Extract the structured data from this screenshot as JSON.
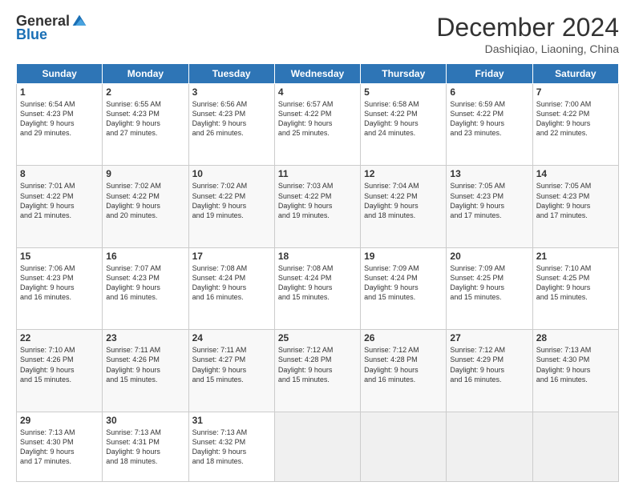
{
  "logo": {
    "general": "General",
    "blue": "Blue"
  },
  "header": {
    "title": "December 2024",
    "location": "Dashiqiao, Liaoning, China"
  },
  "days_of_week": [
    "Sunday",
    "Monday",
    "Tuesday",
    "Wednesday",
    "Thursday",
    "Friday",
    "Saturday"
  ],
  "weeks": [
    [
      {
        "day": "1",
        "rise": "6:54 AM",
        "set": "4:23 PM",
        "hours": "9",
        "mins": "29"
      },
      {
        "day": "2",
        "rise": "6:55 AM",
        "set": "4:23 PM",
        "hours": "9",
        "mins": "27"
      },
      {
        "day": "3",
        "rise": "6:56 AM",
        "set": "4:23 PM",
        "hours": "9",
        "mins": "26"
      },
      {
        "day": "4",
        "rise": "6:57 AM",
        "set": "4:22 PM",
        "hours": "9",
        "mins": "25"
      },
      {
        "day": "5",
        "rise": "6:58 AM",
        "set": "4:22 PM",
        "hours": "9",
        "mins": "24"
      },
      {
        "day": "6",
        "rise": "6:59 AM",
        "set": "4:22 PM",
        "hours": "9",
        "mins": "23"
      },
      {
        "day": "7",
        "rise": "7:00 AM",
        "set": "4:22 PM",
        "hours": "9",
        "mins": "22"
      }
    ],
    [
      {
        "day": "8",
        "rise": "7:01 AM",
        "set": "4:22 PM",
        "hours": "9",
        "mins": "21"
      },
      {
        "day": "9",
        "rise": "7:02 AM",
        "set": "4:22 PM",
        "hours": "9",
        "mins": "20"
      },
      {
        "day": "10",
        "rise": "7:02 AM",
        "set": "4:22 PM",
        "hours": "9",
        "mins": "19"
      },
      {
        "day": "11",
        "rise": "7:03 AM",
        "set": "4:22 PM",
        "hours": "9",
        "mins": "19"
      },
      {
        "day": "12",
        "rise": "7:04 AM",
        "set": "4:22 PM",
        "hours": "9",
        "mins": "18"
      },
      {
        "day": "13",
        "rise": "7:05 AM",
        "set": "4:23 PM",
        "hours": "9",
        "mins": "17"
      },
      {
        "day": "14",
        "rise": "7:05 AM",
        "set": "4:23 PM",
        "hours": "9",
        "mins": "17"
      }
    ],
    [
      {
        "day": "15",
        "rise": "7:06 AM",
        "set": "4:23 PM",
        "hours": "9",
        "mins": "16"
      },
      {
        "day": "16",
        "rise": "7:07 AM",
        "set": "4:23 PM",
        "hours": "9",
        "mins": "16"
      },
      {
        "day": "17",
        "rise": "7:08 AM",
        "set": "4:24 PM",
        "hours": "9",
        "mins": "16"
      },
      {
        "day": "18",
        "rise": "7:08 AM",
        "set": "4:24 PM",
        "hours": "9",
        "mins": "15"
      },
      {
        "day": "19",
        "rise": "7:09 AM",
        "set": "4:24 PM",
        "hours": "9",
        "mins": "15"
      },
      {
        "day": "20",
        "rise": "7:09 AM",
        "set": "4:25 PM",
        "hours": "9",
        "mins": "15"
      },
      {
        "day": "21",
        "rise": "7:10 AM",
        "set": "4:25 PM",
        "hours": "9",
        "mins": "15"
      }
    ],
    [
      {
        "day": "22",
        "rise": "7:10 AM",
        "set": "4:26 PM",
        "hours": "9",
        "mins": "15"
      },
      {
        "day": "23",
        "rise": "7:11 AM",
        "set": "4:26 PM",
        "hours": "9",
        "mins": "15"
      },
      {
        "day": "24",
        "rise": "7:11 AM",
        "set": "4:27 PM",
        "hours": "9",
        "mins": "15"
      },
      {
        "day": "25",
        "rise": "7:12 AM",
        "set": "4:28 PM",
        "hours": "9",
        "mins": "15"
      },
      {
        "day": "26",
        "rise": "7:12 AM",
        "set": "4:28 PM",
        "hours": "9",
        "mins": "16"
      },
      {
        "day": "27",
        "rise": "7:12 AM",
        "set": "4:29 PM",
        "hours": "9",
        "mins": "16"
      },
      {
        "day": "28",
        "rise": "7:13 AM",
        "set": "4:30 PM",
        "hours": "9",
        "mins": "16"
      }
    ],
    [
      {
        "day": "29",
        "rise": "7:13 AM",
        "set": "4:30 PM",
        "hours": "9",
        "mins": "17"
      },
      {
        "day": "30",
        "rise": "7:13 AM",
        "set": "4:31 PM",
        "hours": "9",
        "mins": "18"
      },
      {
        "day": "31",
        "rise": "7:13 AM",
        "set": "4:32 PM",
        "hours": "9",
        "mins": "18"
      },
      null,
      null,
      null,
      null
    ]
  ],
  "labels": {
    "sunrise": "Sunrise:",
    "sunset": "Sunset:",
    "daylight": "Daylight:",
    "hours": "hours",
    "and": "and",
    "minutes": "minutes."
  }
}
